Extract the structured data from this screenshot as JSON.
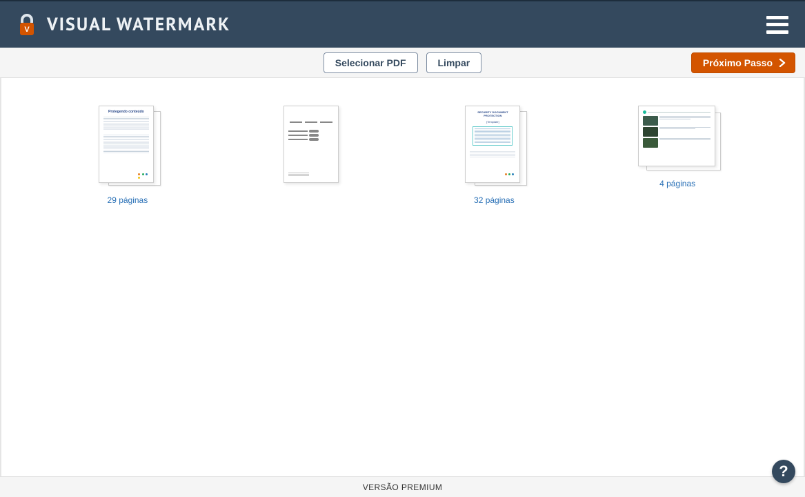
{
  "header": {
    "app_title": "VISUAL WATERMARK"
  },
  "toolbar": {
    "select_pdf_label": "Selecionar PDF",
    "clear_label": "Limpar",
    "next_step_label": "Próximo Passo"
  },
  "documents": [
    {
      "pages_label": "29 páginas"
    },
    {
      "pages_label": ""
    },
    {
      "pages_label": "32 páginas"
    },
    {
      "pages_label": "4 páginas"
    }
  ],
  "footer": {
    "premium_label": "VERSÃO PREMIUM"
  },
  "help": {
    "glyph": "?"
  }
}
